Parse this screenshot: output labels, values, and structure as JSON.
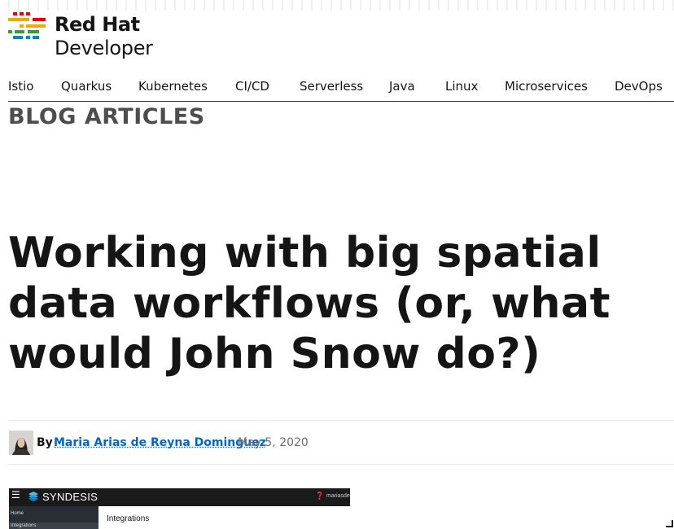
{
  "brand": {
    "line1": "Red Hat",
    "line2": "Developer",
    "colors": [
      "#ee0000",
      "#f0ab00",
      "#3f9c35",
      "#0088ce",
      "#151515"
    ]
  },
  "nav": {
    "items": [
      {
        "label": "Istio"
      },
      {
        "label": "Quarkus"
      },
      {
        "label": "Kubernetes"
      },
      {
        "label": "CI/CD"
      },
      {
        "label": "Serverless"
      },
      {
        "label": "Java"
      },
      {
        "label": "Linux"
      },
      {
        "label": "Microservices"
      },
      {
        "label": "DevOps"
      }
    ]
  },
  "section": {
    "title": "BLOG ARTICLES"
  },
  "article": {
    "title": "Working with big spatial data workflows (or, what would John Snow do?)",
    "byline": {
      "by": "By",
      "author": "Maria Arias de Reyna Dominguez",
      "date": "May 5, 2020"
    }
  },
  "hero_image": {
    "menu_icon": "hamburger-icon",
    "brand": "SYNDESIS",
    "help_icon": "help-icon",
    "user": "mariasde",
    "sidebar": [
      "Home",
      "Integrations"
    ],
    "heading": "Integrations"
  },
  "colors": {
    "text": "#151515",
    "link": "#0066cc",
    "muted": "#6a6e73",
    "section": "#4d4d4d"
  }
}
